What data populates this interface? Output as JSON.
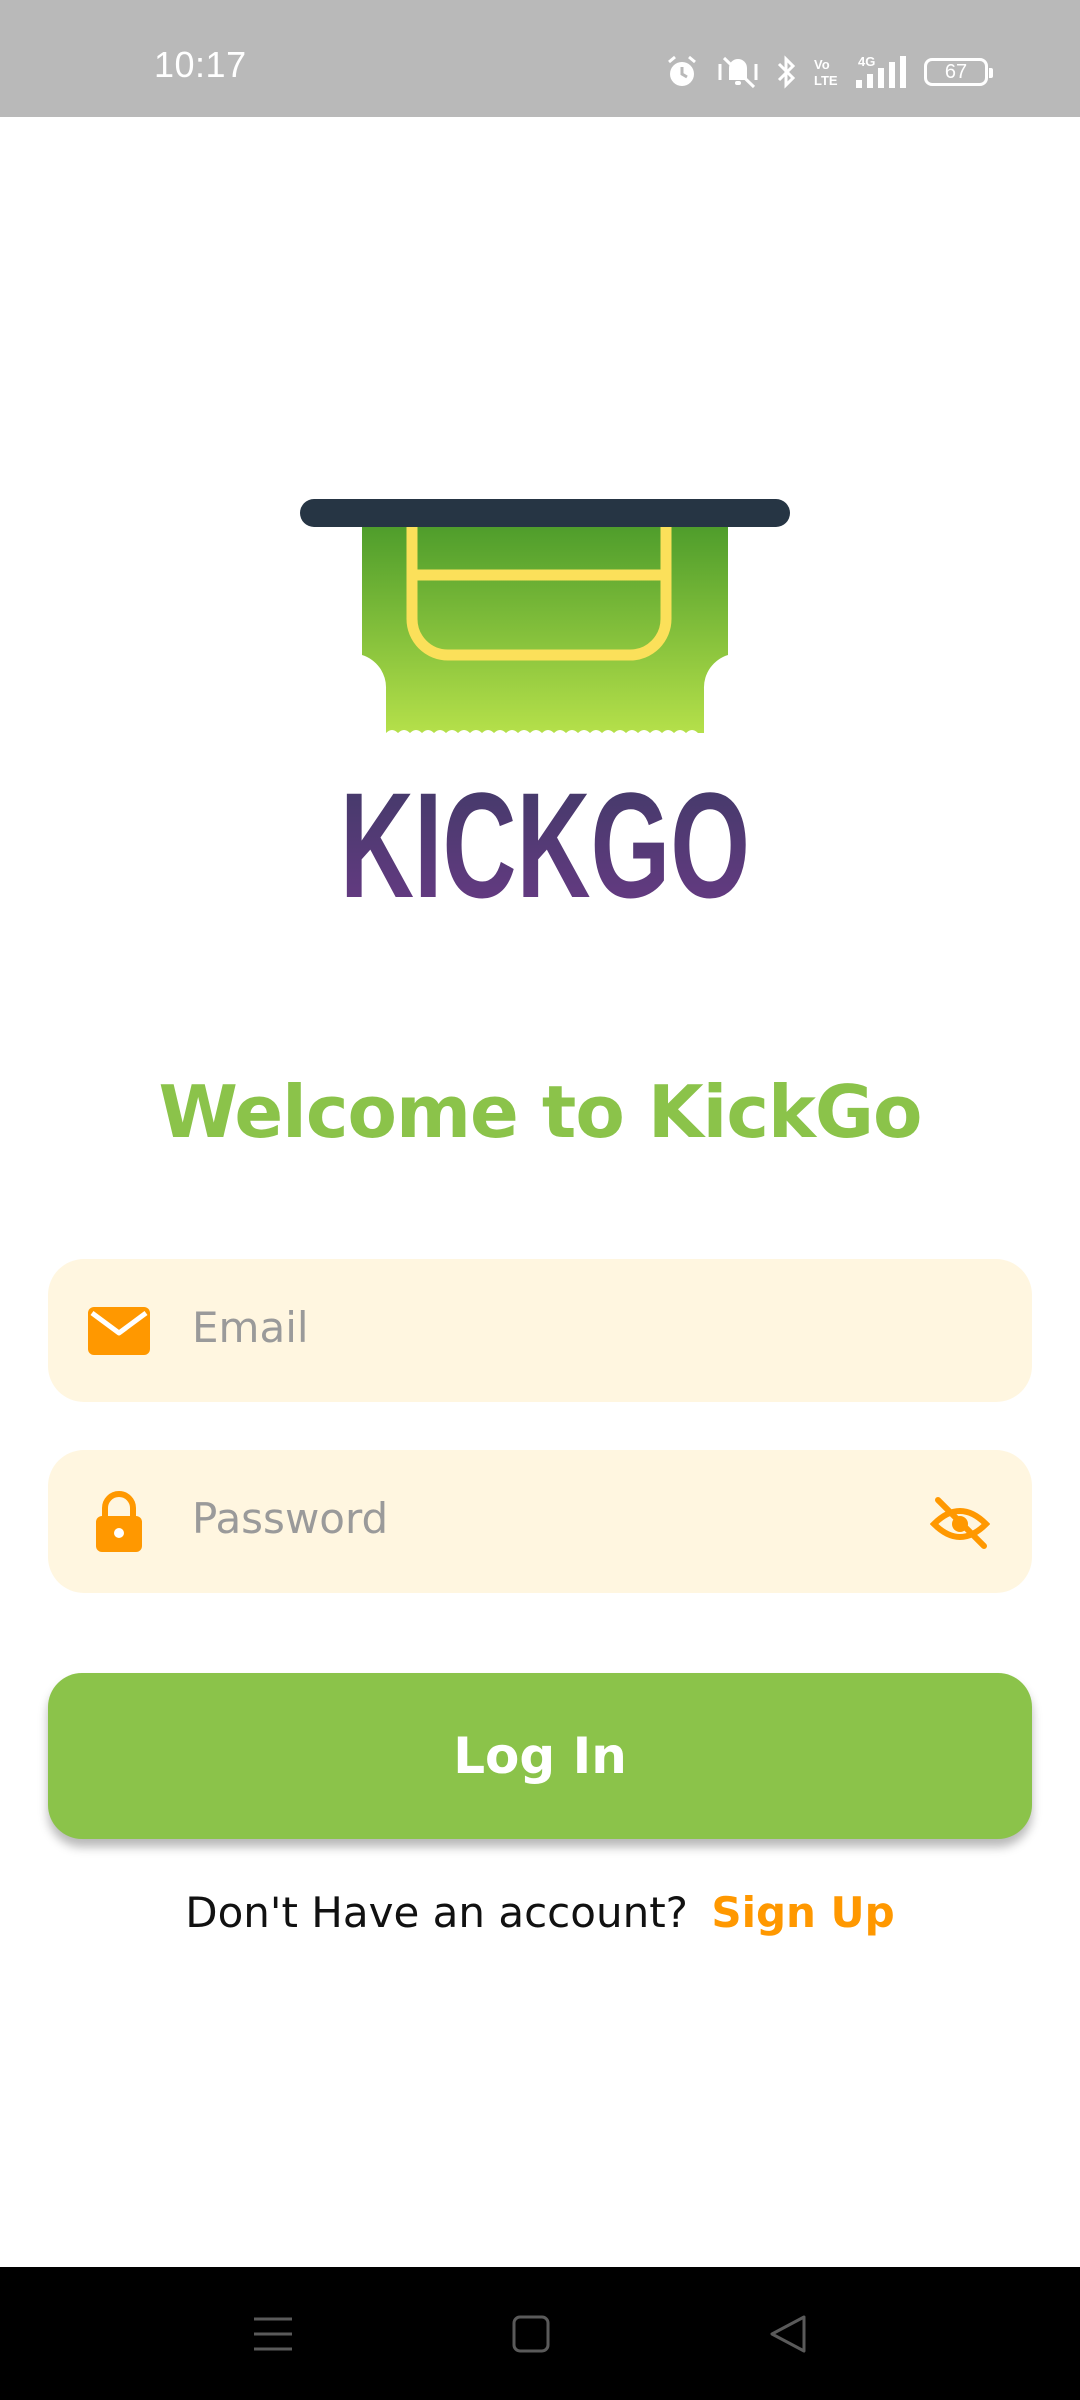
{
  "status_bar": {
    "time": "10:17",
    "battery_level": "67",
    "icons": [
      "alarm-icon",
      "mute-vibrate-icon",
      "bluetooth-icon",
      "volte-icon",
      "4g-signal-icon",
      "battery-icon"
    ]
  },
  "logo": {
    "text": "KICKGO",
    "icon": "ticket-logo-icon",
    "colors": {
      "ticket_top": "#4a9a2a",
      "ticket_bottom": "#b5e04a",
      "ticket_outline": "#fbe05a",
      "slot": "#263544",
      "wordmark_top": "#3f3a66",
      "wordmark_bottom": "#6a3a86"
    }
  },
  "welcome": {
    "title": "Welcome to KickGo"
  },
  "form": {
    "email": {
      "placeholder": "Email",
      "icon": "mail-icon"
    },
    "password": {
      "placeholder": "Password",
      "icon": "lock-icon",
      "toggle_icon": "eye-off-icon"
    },
    "login_label": "Log In"
  },
  "signup": {
    "prompt": "Don't Have an account?",
    "link": "Sign Up"
  },
  "nav_bar": {
    "icons": [
      "menu-icon",
      "home-icon",
      "back-icon"
    ]
  },
  "colors": {
    "accent_green": "#8bc34a",
    "accent_orange": "#ff9800",
    "field_bg": "#fff6e0",
    "status_bar_bg": "#b9b9b9"
  }
}
